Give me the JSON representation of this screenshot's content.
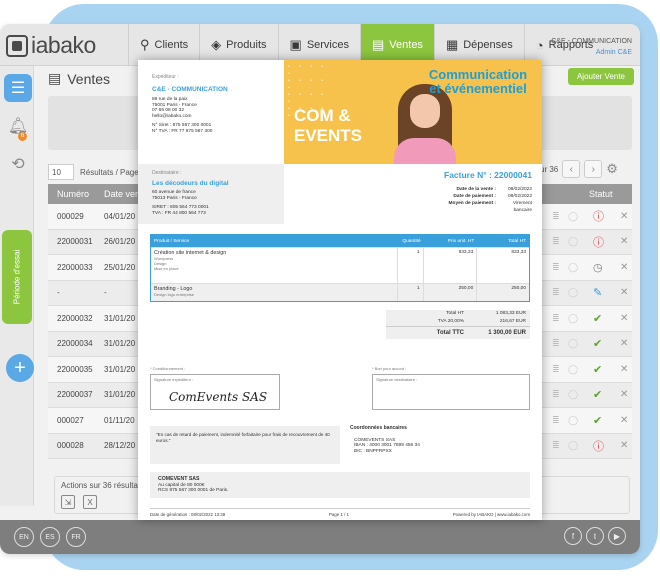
{
  "app": {
    "logo": "iabako",
    "nav": [
      {
        "label": "Clients",
        "icon": "person-icon"
      },
      {
        "label": "Produits",
        "icon": "tag-icon"
      },
      {
        "label": "Services",
        "icon": "briefcase-icon"
      },
      {
        "label": "Ventes",
        "icon": "register-icon",
        "active": true
      },
      {
        "label": "Dépenses",
        "icon": "calculator-icon"
      },
      {
        "label": "Rapports",
        "icon": "chart-icon"
      }
    ],
    "account": {
      "company": "C&E - COMMUNICATION",
      "user": "Admin C&E"
    }
  },
  "sidebar": {
    "trial_label": "Période d'essai",
    "notification_count": "6"
  },
  "page": {
    "title": "Ventes",
    "add_button": "Ajouter Vente",
    "per_page_value": "10",
    "per_page_label": "Résultats / Page",
    "pagination_label": "sur 36",
    "columns": {
      "number": "Numéro",
      "date": "Date vente",
      "status": "Statut"
    },
    "rows": [
      {
        "number": "000029",
        "date": "04/01/20",
        "status": "error"
      },
      {
        "number": "22000031",
        "date": "26/01/20",
        "status": "error"
      },
      {
        "number": "22000033",
        "date": "25/01/20",
        "status": "clock"
      },
      {
        "number": "-",
        "date": "-",
        "status": "edit"
      },
      {
        "number": "22000032",
        "date": "31/01/20",
        "status": "check"
      },
      {
        "number": "22000034",
        "date": "31/01/20",
        "status": "check"
      },
      {
        "number": "22000035",
        "date": "31/01/20",
        "status": "check"
      },
      {
        "number": "22000037",
        "date": "31/01/20",
        "status": "check"
      },
      {
        "number": "000027",
        "date": "01/11/20",
        "status": "check"
      },
      {
        "number": "000028",
        "date": "28/12/20",
        "status": "error"
      }
    ],
    "actions_label": "Actions sur 36 résultats"
  },
  "footer": {
    "languages": [
      "EN",
      "ES",
      "FR"
    ],
    "social": [
      "f",
      "t",
      "▶"
    ]
  },
  "invoice": {
    "sender_label": "Expéditeur :",
    "sender_name": "C&E - COMMUNICATION",
    "sender_lines": [
      "89 rue de la paix",
      "75001 Paris - France",
      "07 66 08 00 32",
      "hello@iabako.com",
      "",
      "N° Siret : 875 567 300 0001",
      "N° TVA : FR 77 875 567 300"
    ],
    "banner_title": "Communication et événementiel",
    "banner_brand_1": "COM &",
    "banner_brand_2": "EVENTS",
    "dest_label": "Destinataire :",
    "dest_name": "Les décodeurs du digital",
    "dest_lines": [
      "60 avenue de france",
      "75013 Paris - France",
      "",
      "SIRET : 805 564 773 0001",
      "TVA : FR 44 800 564 773"
    ],
    "number": "Facture N° : 22000041",
    "info": [
      {
        "k": "Date de la vente :",
        "v": "08/02/2022"
      },
      {
        "k": "Date de paiement :",
        "v": "08/02/2022"
      },
      {
        "k": "Moyen de paiement :",
        "v": "Virement bancaire"
      }
    ],
    "table_head": {
      "product": "Produit / Service",
      "qty": "Quantité",
      "unit": "Prix unit. HT",
      "total": "Total HT"
    },
    "items": [
      {
        "name": "Création site internet & design",
        "sub": "Wordpress\nDesign\nMise en place",
        "qty": "1",
        "unit": "833,33",
        "total": "833,33"
      },
      {
        "name": "Branding - Logo",
        "sub": "Design logo entreprise",
        "qty": "1",
        "unit": "250,00",
        "total": "250,00"
      }
    ],
    "totals": [
      {
        "k": "Total HT",
        "v": "1 083,33 EUR"
      },
      {
        "k": "TVA 20,00%",
        "v": "216,67 EUR"
      },
      {
        "k": "Total TTC",
        "v": "1 300,00 EUR"
      }
    ],
    "conditions_label": "* Conditionnement :",
    "bon_label": "* Bon pour accord :",
    "sig_sender_label": "Signature expéditeur :",
    "sig_dest_label": "Signature destinataire :",
    "signature": "ComEvents SAS",
    "late_note": "\"En cas de retard de paiement, indemnité forfaitaire pour frais de recouvrement de 40 euros.\"",
    "bank_title": "Coordonnées bancaires",
    "bank_lines": [
      "COMEVENTS SAS",
      "IBAN : 4000 3001 7899 456 34",
      "BIC : BNPFRPXX"
    ],
    "company_name": "COMEVENT SAS",
    "company_lines": [
      "Au capital de 80 000€",
      "RCS 875 567 300 0001 de Paris."
    ],
    "gen_date": "Date de génération : 08/02/2022 13:38",
    "page": "Page 1 / 1",
    "powered": "Powered by IABAKO | www.iabako.com"
  }
}
